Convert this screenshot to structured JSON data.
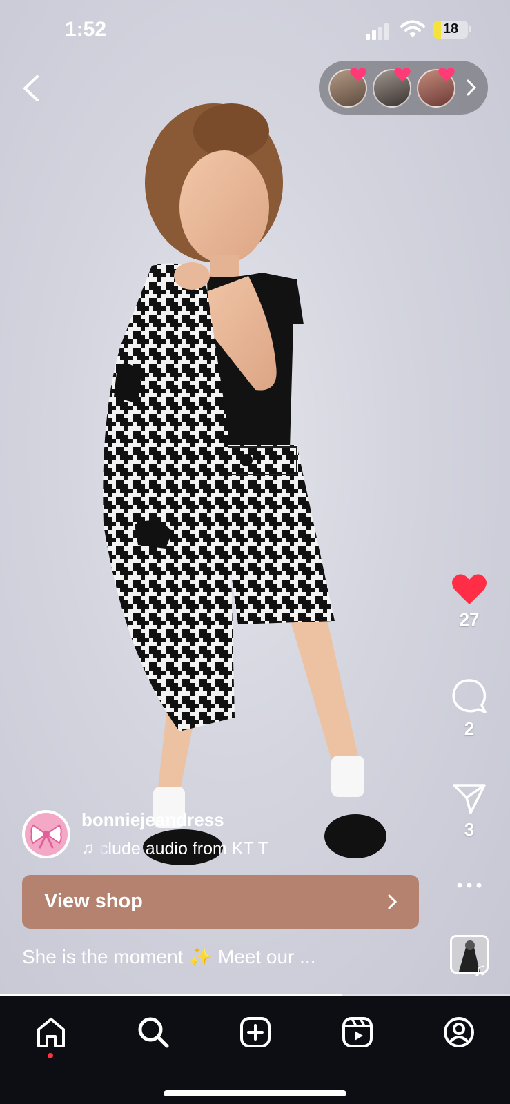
{
  "status_bar": {
    "time": "1:52",
    "battery": "18"
  },
  "nav": {
    "back_icon": "chevron-left-icon"
  },
  "viewers": {
    "avatars": 3,
    "icon": "chevron-right-icon"
  },
  "actions": {
    "likes": "27",
    "comments": "2",
    "shares": "3",
    "like_color": "#ff2d45"
  },
  "post": {
    "username": "bonniejeandress",
    "audio": "clude audio from KT T",
    "caption": "She is the moment ✨ Meet our ...",
    "shop_label": "View shop"
  },
  "colors": {
    "shop_button": "#b5826f",
    "nav_background": "#0d0d14",
    "avatar_pink": "#f3a9c6"
  },
  "progress": 0.67,
  "bottom_nav": [
    "home-icon",
    "search-icon",
    "create-icon",
    "reels-icon",
    "profile-icon"
  ]
}
